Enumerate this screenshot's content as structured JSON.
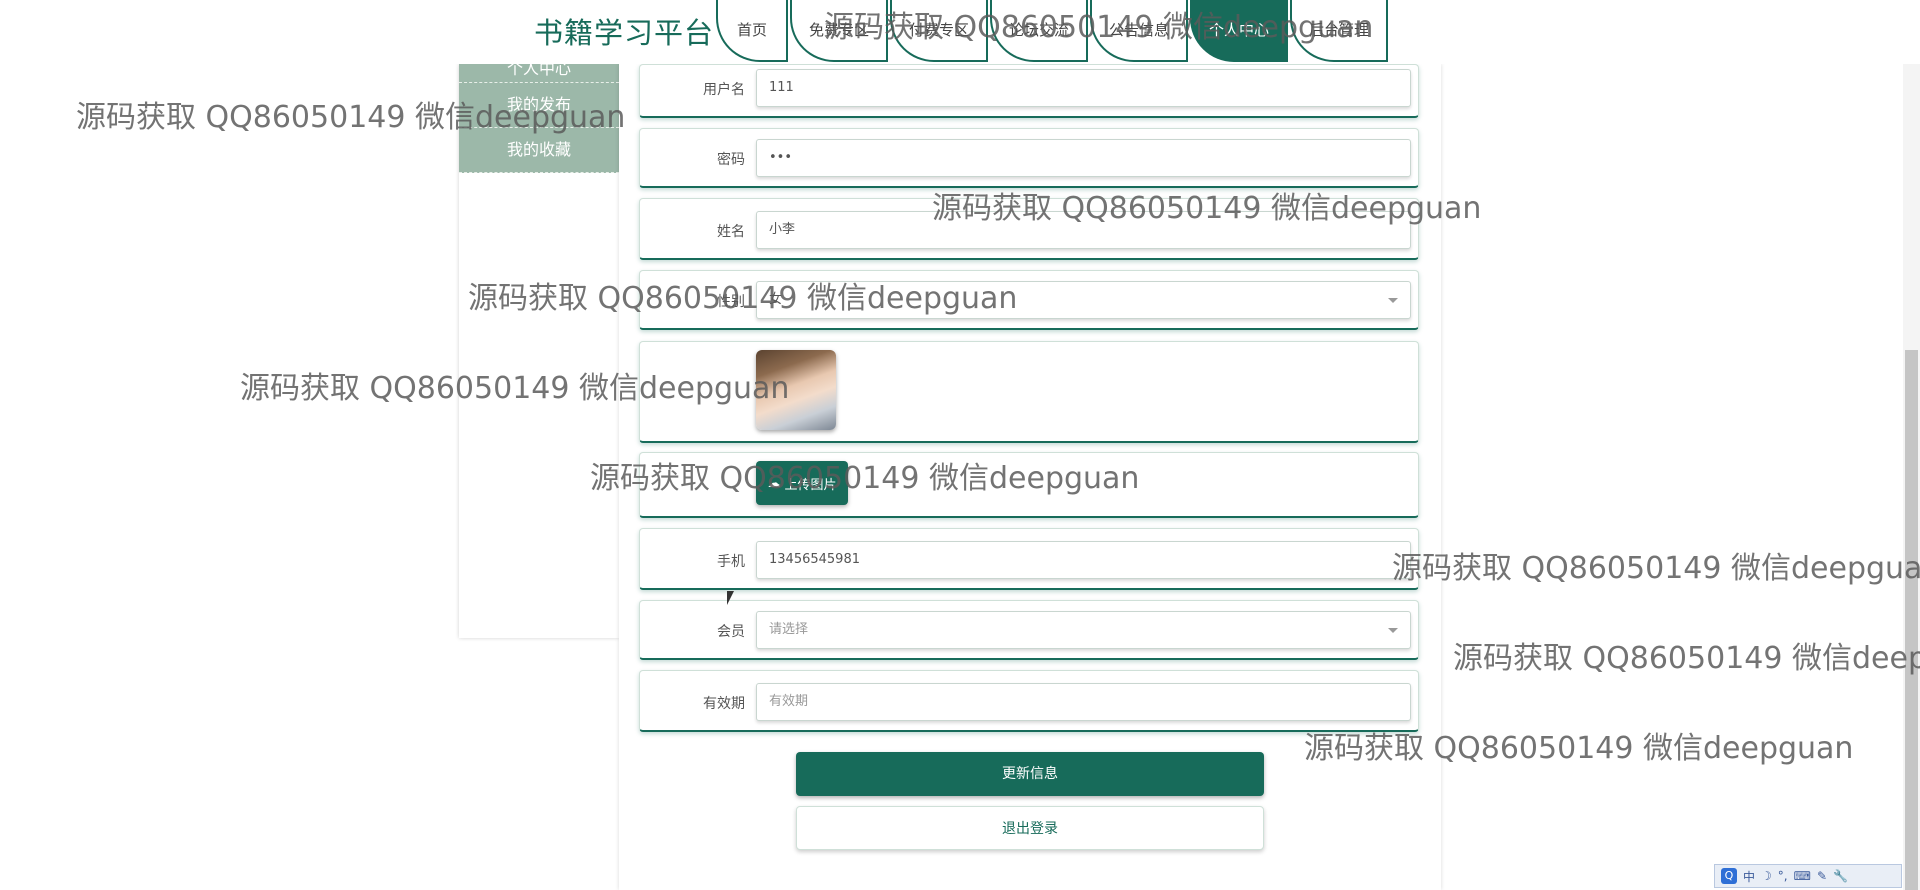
{
  "header": {
    "brand": "书籍学习平台",
    "nav": [
      {
        "label": "首页"
      },
      {
        "label": "免费专区"
      },
      {
        "label": "付费专区"
      },
      {
        "label": "论坛交流"
      },
      {
        "label": "公告信息"
      },
      {
        "label": "个人中心",
        "active": true
      },
      {
        "label": "后台管理"
      }
    ]
  },
  "sidebar": {
    "items": [
      {
        "label": "个人中心"
      },
      {
        "label": "我的发布"
      },
      {
        "label": "我的收藏"
      }
    ]
  },
  "form": {
    "username_label": "用户名",
    "username_value": "111",
    "password_label": "密码",
    "password_value": "•••",
    "name_label": "姓名",
    "name_value": "小李",
    "gender_label": "性别",
    "gender_value": "女",
    "upload_label": "上传图片",
    "phone_label": "手机",
    "phone_value": "13456545981",
    "member_label": "会员",
    "member_placeholder": "请选择",
    "validity_label": "有效期",
    "validity_placeholder": "有效期"
  },
  "buttons": {
    "update": "更新信息",
    "logout": "退出登录"
  },
  "ime": {
    "logo": "Q",
    "lang": "中"
  },
  "watermark": "源码获取 QQ86050149 微信deepguan",
  "colors": {
    "accent": "#176b5a",
    "sidebar": "#9cb8a9"
  }
}
